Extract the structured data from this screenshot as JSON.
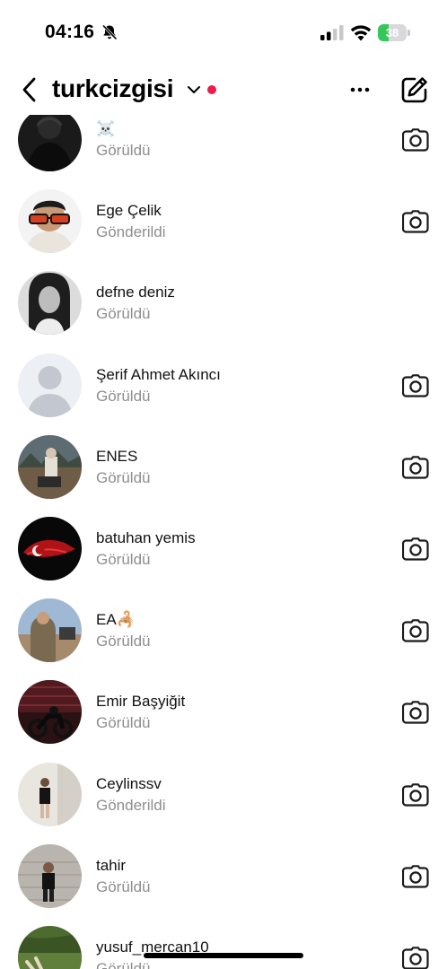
{
  "status_bar": {
    "time": "04:16",
    "battery_level": "38",
    "battery_percent": 0.38,
    "battery_color": "#35c759",
    "icons": [
      "bell-slash-icon",
      "cellular-signal-icon",
      "wifi-icon",
      "battery-icon"
    ]
  },
  "header": {
    "account_name": "turkcizgisi",
    "has_unread_indicator": true,
    "accent_color": "#ed1c4d",
    "icons": [
      "chevron-left-icon",
      "chevron-down-icon",
      "more-icon",
      "compose-icon"
    ]
  },
  "threads": [
    {
      "name": "☠️",
      "status": "Görüldü",
      "camera": true,
      "avatar_desc": "dark photo"
    },
    {
      "name": "Ege Çelik",
      "status": "Gönderildi",
      "camera": true,
      "avatar_desc": "man with sunglasses"
    },
    {
      "name": "defne deniz",
      "status": "Görüldü",
      "camera": false,
      "avatar_desc": "black and white portrait"
    },
    {
      "name": "Şerif Ahmet Akıncı",
      "status": "Görüldü",
      "camera": true,
      "avatar_desc": "default silhouette"
    },
    {
      "name": "ENES",
      "status": "Görüldü",
      "camera": true,
      "avatar_desc": "outdoor photo"
    },
    {
      "name": "batuhan yemis",
      "status": "Görüldü",
      "camera": true,
      "avatar_desc": "turkish flag"
    },
    {
      "name": "EA🦂",
      "status": "Görüldü",
      "camera": true,
      "avatar_desc": "man in desert"
    },
    {
      "name": "Emir Başyiğit",
      "status": "Görüldü",
      "camera": true,
      "avatar_desc": "motorcycle night"
    },
    {
      "name": "Ceylinssv",
      "status": "Gönderildi",
      "camera": true,
      "avatar_desc": "person standing"
    },
    {
      "name": "tahir",
      "status": "Görüldü",
      "camera": true,
      "avatar_desc": "person in front of wall"
    },
    {
      "name": "yusuf_mercan10",
      "status": "Görüldü",
      "camera": true,
      "avatar_desc": "grass field"
    }
  ]
}
